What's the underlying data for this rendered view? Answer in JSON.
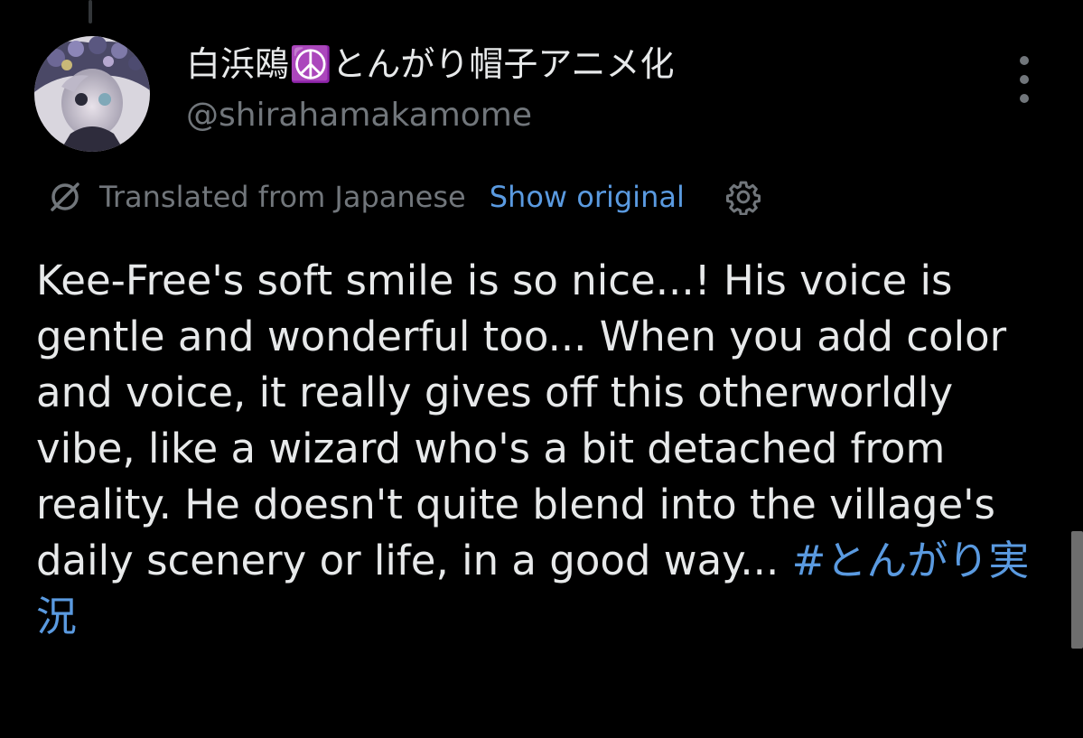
{
  "author": {
    "display_name": "白浜鴎☮️とんがり帽子アニメ化",
    "handle": "@shirahamakamome"
  },
  "translation": {
    "label": "Translated from Japanese",
    "show_original": "Show original"
  },
  "tweet": {
    "text": "Kee-Free's soft smile is so nice...! His voice is gentle and wonderful too... When you add color and voice, it really gives off this otherworldly vibe, like a wizard who's a bit detached from reality. He doesn't quite blend into the village's daily scenery or life, in a good way...",
    "hashtag": "#とんがり実況"
  },
  "icons": {
    "more": "more-vertical-icon",
    "translate": "translate-icon",
    "settings": "gear-icon"
  },
  "colors": {
    "background": "#000000",
    "primary_text": "#e7e9ea",
    "secondary_text": "#71767b",
    "link": "#5a9ae0"
  }
}
